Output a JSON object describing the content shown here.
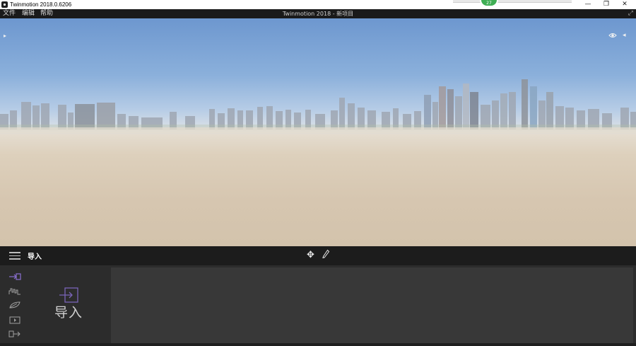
{
  "window": {
    "title": "Twinmotion 2018.0.6206",
    "notification_count": "27",
    "controls": {
      "minimize": "—",
      "maximize": "❐",
      "close": "✕"
    }
  },
  "menubar": {
    "items": [
      "文件",
      "编辑",
      "帮助"
    ],
    "document_title": "Twinmotion 2018 - 新项目",
    "fullscreen_icon": "⤢"
  },
  "viewport": {
    "left_arrow": "▸",
    "right_arrow": "◂"
  },
  "toolbar": {
    "section_title": "导入",
    "move_icon": "✥"
  },
  "panel": {
    "import_label": "导入",
    "nav_items": [
      "import",
      "terrain",
      "vegetation",
      "media",
      "export"
    ]
  },
  "colors": {
    "accent": "#8a6fd0",
    "panel_bg": "#2c2c2c",
    "content_bg": "#383838",
    "toolbar_bg": "#1c1c1c"
  }
}
